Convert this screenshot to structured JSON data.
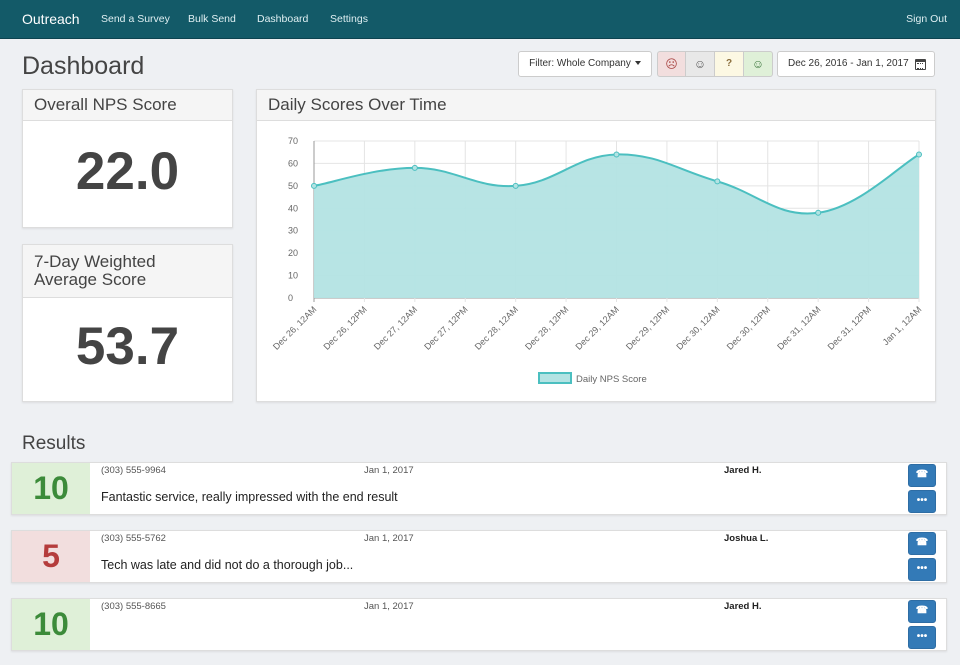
{
  "nav": {
    "brand": "Outreach",
    "links": [
      "Send a Survey",
      "Bulk Send",
      "Dashboard",
      "Settings"
    ],
    "signout": "Sign Out"
  },
  "page": {
    "title": "Dashboard"
  },
  "filters": {
    "company_filter": "Filter: Whole Company",
    "mood_buttons": [
      "☹",
      "☺",
      "?",
      "☺"
    ],
    "date_range": "Dec 26, 2016 - Jan 1, 2017"
  },
  "overall": {
    "title": "Overall NPS Score",
    "value": "22.0"
  },
  "weighted": {
    "title": "7-Day Weighted Average Score",
    "value": "53.7"
  },
  "chart_panel": {
    "title": "Daily Scores Over Time"
  },
  "chart_data": {
    "type": "area",
    "title": "Daily Scores Over Time",
    "x": [
      "Dec 26, 12AM",
      "Dec 26, 12PM",
      "Dec 27, 12AM",
      "Dec 27, 12PM",
      "Dec 28, 12AM",
      "Dec 28, 12PM",
      "Dec 29, 12AM",
      "Dec 29, 12PM",
      "Dec 30, 12AM",
      "Dec 30, 12PM",
      "Dec 31, 12AM",
      "Dec 31, 12PM",
      "Jan 1, 12AM"
    ],
    "series": [
      {
        "name": "Daily NPS Score",
        "points": [
          {
            "x": "Dec 26, 12AM",
            "y": 50
          },
          {
            "x": "Dec 27, 12AM",
            "y": 58
          },
          {
            "x": "Dec 28, 12AM",
            "y": 50
          },
          {
            "x": "Dec 29, 12AM",
            "y": 64
          },
          {
            "x": "Dec 30, 12AM",
            "y": 52
          },
          {
            "x": "Dec 31, 12AM",
            "y": 38
          },
          {
            "x": "Jan 1, 12AM",
            "y": 64
          }
        ]
      }
    ],
    "ylim": [
      0,
      70
    ],
    "yticks": [
      0,
      10,
      20,
      30,
      40,
      50,
      60,
      70
    ],
    "grid": true,
    "legend": "bottom",
    "colors": {
      "line": "#4bbfc0",
      "fill": "#b3e3e3"
    }
  },
  "results": {
    "title": "Results",
    "items": [
      {
        "score": "10",
        "tone": "good",
        "phone": "(303) 555-9964",
        "date": "Jan 1, 2017",
        "name": "Jared H.",
        "comment": "Fantastic service, really impressed with the end result"
      },
      {
        "score": "5",
        "tone": "bad",
        "phone": "(303) 555-5762",
        "date": "Jan 1, 2017",
        "name": "Joshua L.",
        "comment": "Tech was late and did not do a thorough job..."
      },
      {
        "score": "10",
        "tone": "good",
        "phone": "(303) 555-8665",
        "date": "Jan 1, 2017",
        "name": "Jared H.",
        "comment": ""
      }
    ],
    "call_icon": "☎",
    "more_icon": "•••"
  }
}
